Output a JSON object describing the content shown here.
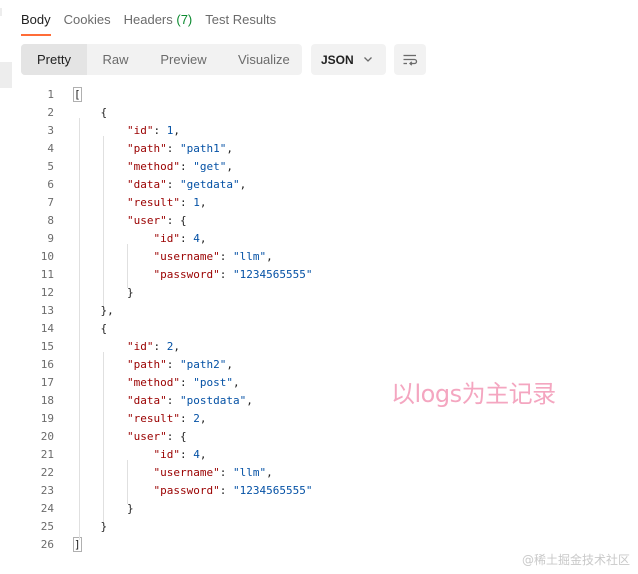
{
  "tabs": [
    {
      "label": "Body",
      "active": true
    },
    {
      "label": "Cookies",
      "active": false
    },
    {
      "label": "Headers",
      "count": "(7)",
      "active": false
    },
    {
      "label": "Test Results",
      "active": false
    }
  ],
  "view_modes": [
    {
      "label": "Pretty",
      "active": true
    },
    {
      "label": "Raw",
      "active": false
    },
    {
      "label": "Preview",
      "active": false
    },
    {
      "label": "Visualize",
      "active": false
    }
  ],
  "format": {
    "selected": "JSON"
  },
  "icons": {
    "format_dropdown": "chevron-down-icon",
    "wrap": "wrap-lines-icon"
  },
  "colors": {
    "active_tab_underline": "#ff6c37",
    "headers_count": "#0b8a2f",
    "json_key": "#9a0000",
    "json_value": "#0451a5",
    "watermark": "#f4a6c0"
  },
  "code_lines": [
    {
      "n": "1",
      "t": "["
    },
    {
      "n": "2",
      "t": "    {"
    },
    {
      "n": "3",
      "t": "        \"id\": 1,"
    },
    {
      "n": "4",
      "t": "        \"path\": \"path1\","
    },
    {
      "n": "5",
      "t": "        \"method\": \"get\","
    },
    {
      "n": "6",
      "t": "        \"data\": \"getdata\","
    },
    {
      "n": "7",
      "t": "        \"result\": 1,"
    },
    {
      "n": "8",
      "t": "        \"user\": {"
    },
    {
      "n": "9",
      "t": "            \"id\": 4,"
    },
    {
      "n": "10",
      "t": "            \"username\": \"llm\","
    },
    {
      "n": "11",
      "t": "            \"password\": \"1234565555\""
    },
    {
      "n": "12",
      "t": "        }"
    },
    {
      "n": "13",
      "t": "    },"
    },
    {
      "n": "14",
      "t": "    {"
    },
    {
      "n": "15",
      "t": "        \"id\": 2,"
    },
    {
      "n": "16",
      "t": "        \"path\": \"path2\","
    },
    {
      "n": "17",
      "t": "        \"method\": \"post\","
    },
    {
      "n": "18",
      "t": "        \"data\": \"postdata\","
    },
    {
      "n": "19",
      "t": "        \"result\": 2,"
    },
    {
      "n": "20",
      "t": "        \"user\": {"
    },
    {
      "n": "21",
      "t": "            \"id\": 4,"
    },
    {
      "n": "22",
      "t": "            \"username\": \"llm\","
    },
    {
      "n": "23",
      "t": "            \"password\": \"1234565555\""
    },
    {
      "n": "24",
      "t": "        }"
    },
    {
      "n": "25",
      "t": "    }"
    },
    {
      "n": "26",
      "t": "]"
    }
  ],
  "watermark": "以logs为主记录",
  "corner_mark": "@稀土掘金技术社区"
}
